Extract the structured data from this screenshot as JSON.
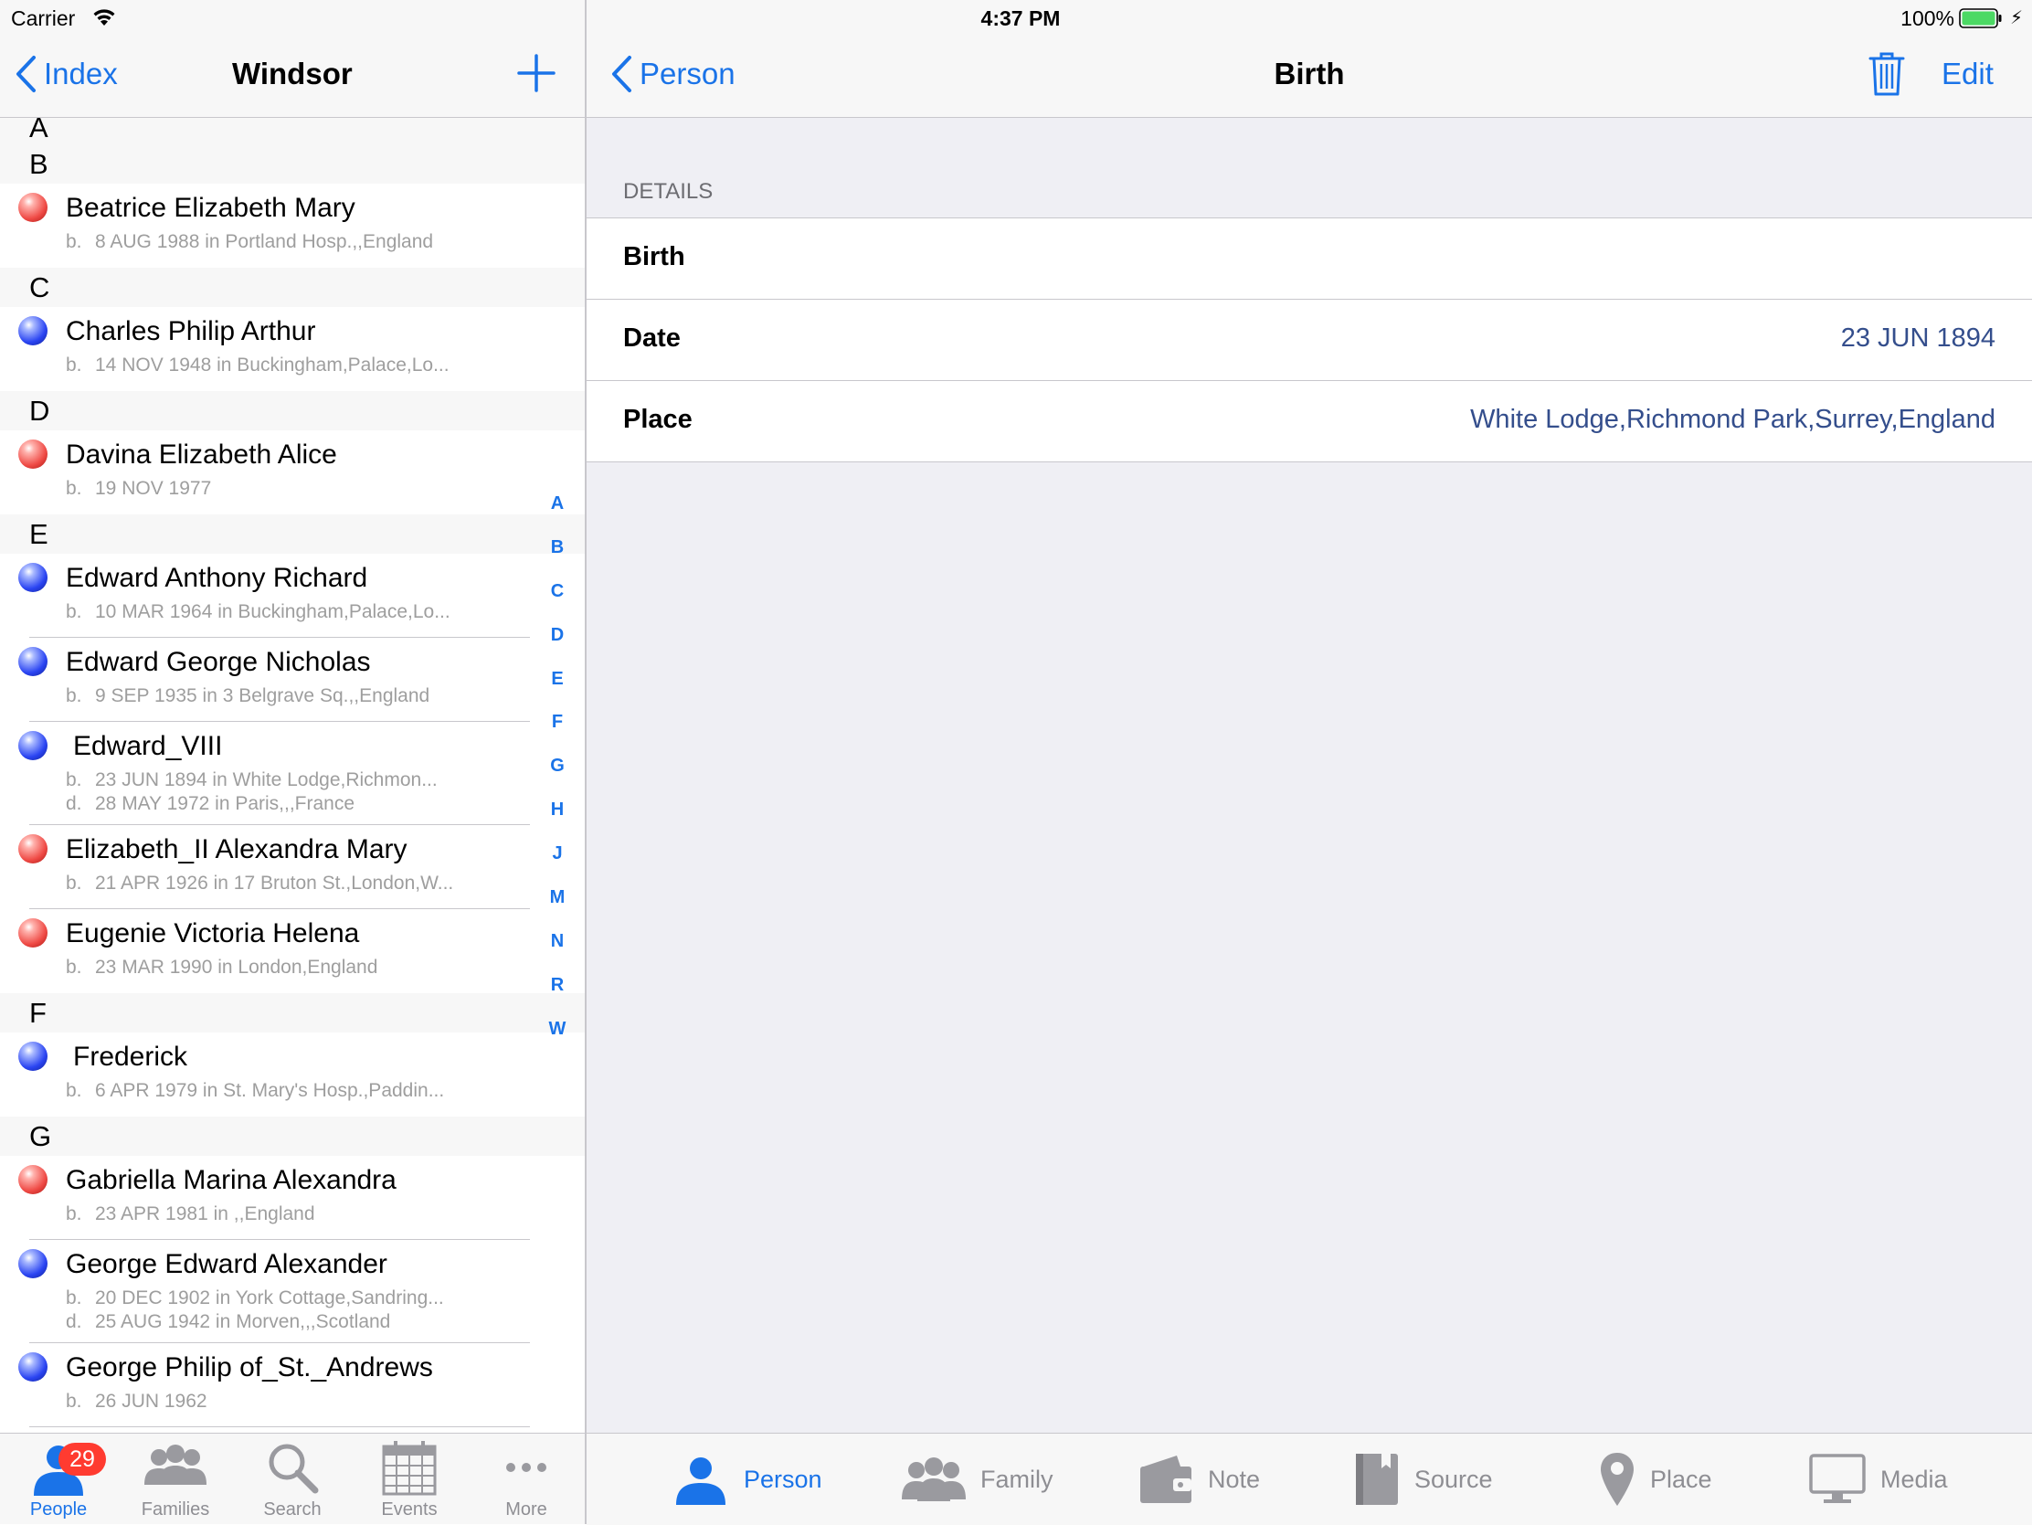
{
  "status": {
    "carrier": "Carrier",
    "time": "4:37 PM",
    "battery": "100%"
  },
  "left_nav": {
    "back_label": "Index",
    "title": "Windsor"
  },
  "people": {
    "sections": [
      {
        "letter": "A",
        "people": []
      },
      {
        "letter": "B",
        "people": [
          {
            "name": "Beatrice Elizabeth Mary",
            "gender": "female",
            "birth": "8 AUG 1988 in Portland Hosp.,,England"
          }
        ]
      },
      {
        "letter": "C",
        "people": [
          {
            "name": "Charles Philip Arthur",
            "gender": "male",
            "birth": "14 NOV 1948 in Buckingham,Palace,Lo..."
          }
        ]
      },
      {
        "letter": "D",
        "people": [
          {
            "name": "Davina Elizabeth Alice",
            "gender": "female",
            "birth": "19 NOV 1977"
          }
        ]
      },
      {
        "letter": "E",
        "people": [
          {
            "name": "Edward Anthony Richard",
            "gender": "male",
            "birth": "10 MAR 1964 in Buckingham,Palace,Lo..."
          },
          {
            "name": "Edward George Nicholas",
            "gender": "male",
            "birth": "9 SEP 1935 in 3 Belgrave Sq.,,England"
          },
          {
            "name": "Edward_VIII",
            "gender": "male",
            "birth": "23 JUN 1894 in White Lodge,Richmon...",
            "death": "28 MAY 1972 in Paris,,,France"
          },
          {
            "name": "Elizabeth_II Alexandra Mary",
            "gender": "female",
            "birth": "21 APR 1926 in 17 Bruton St.,London,W..."
          },
          {
            "name": "Eugenie Victoria Helena",
            "gender": "female",
            "birth": "23 MAR 1990 in London,England"
          }
        ]
      },
      {
        "letter": "F",
        "people": [
          {
            "name": "Frederick",
            "gender": "male",
            "birth": "6 APR 1979 in St. Mary's Hosp.,Paddin..."
          }
        ]
      },
      {
        "letter": "G",
        "people": [
          {
            "name": "Gabriella Marina Alexandra",
            "gender": "female",
            "birth": "23 APR 1981 in ,,England"
          },
          {
            "name": "George Edward Alexander",
            "gender": "male",
            "birth": "20 DEC 1902 in York Cottage,Sandring...",
            "death": "25 AUG 1942 in Morven,,,Scotland"
          },
          {
            "name": "George Philip of_St._Andrews",
            "gender": "male",
            "birth": "26 JUN 1962"
          }
        ]
      }
    ],
    "birth_prefix": "b.",
    "death_prefix": "d."
  },
  "index_letters": [
    "A",
    "B",
    "C",
    "D",
    "E",
    "F",
    "G",
    "H",
    "J",
    "M",
    "N",
    "R",
    "W"
  ],
  "left_tabs": {
    "people": "People",
    "people_badge": "29",
    "families": "Families",
    "search": "Search",
    "events": "Events",
    "more": "More"
  },
  "right_nav": {
    "back_label": "Person",
    "title": "Birth",
    "edit_label": "Edit"
  },
  "details": {
    "header": "DETAILS",
    "event_type": "Birth",
    "date_label": "Date",
    "date_value": "23 JUN 1894",
    "place_label": "Place",
    "place_value": "White Lodge,Richmond Park,Surrey,England"
  },
  "right_tabs": {
    "person": "Person",
    "family": "Family",
    "note": "Note",
    "source": "Source",
    "place": "Place",
    "media": "Media"
  },
  "colors": {
    "accent": "#1a73e8",
    "female": "#ef4a45",
    "male": "#2a44f2",
    "value": "#344e8c"
  }
}
